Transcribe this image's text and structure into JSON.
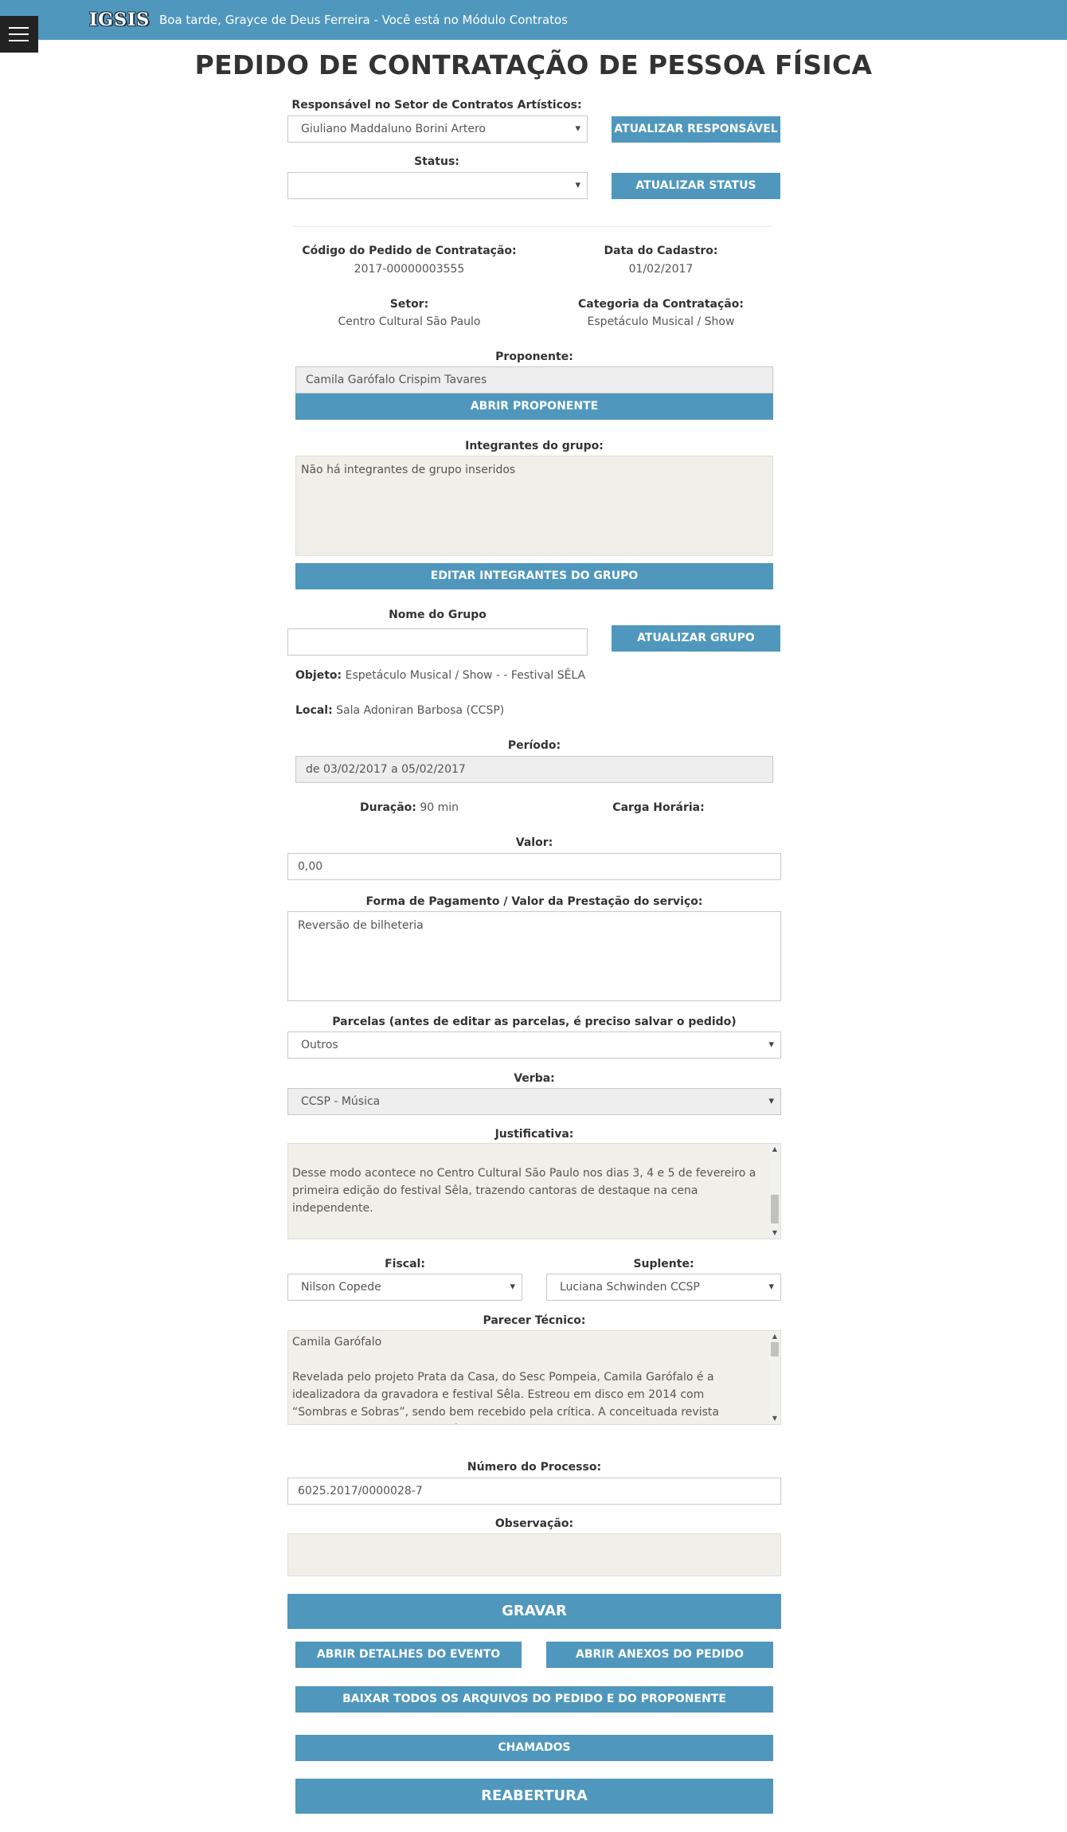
{
  "header": {
    "logo": "IGSIS",
    "greeting": "Boa tarde, Grayce de Deus Ferreira - Você está no Módulo Contratos"
  },
  "page_title": "PEDIDO DE CONTRATAÇÃO DE PESSOA FÍSICA",
  "responsavel": {
    "label": "Responsável no Setor de Contratos Artísticos:",
    "value": "Giuliano Maddaluno Borini Artero",
    "button": "ATUALIZAR RESPONSÁVEL"
  },
  "status": {
    "label": "Status:",
    "value": "",
    "button": "ATUALIZAR STATUS"
  },
  "info": {
    "codigo_label": "Código do Pedido de Contratação:",
    "codigo_value": "2017-00000003555",
    "data_label": "Data do Cadastro:",
    "data_value": "01/02/2017",
    "setor_label": "Setor:",
    "setor_value": "Centro Cultural São Paulo",
    "categoria_label": "Categoria da Contratação:",
    "categoria_value": "Espetáculo Musical / Show"
  },
  "proponente": {
    "label": "Proponente:",
    "value": "Camila Garófalo Crispim Tavares",
    "button": "ABRIR PROPONENTE"
  },
  "integrantes": {
    "label": "Integrantes do grupo:",
    "value": "Não há integrantes de grupo inseridos",
    "button": "EDITAR INTEGRANTES DO GRUPO"
  },
  "grupo": {
    "label": "Nome do Grupo",
    "value": "",
    "button": "ATUALIZAR GRUPO"
  },
  "objeto": {
    "label": "Objeto:",
    "value": "Espetáculo Musical / Show - - Festival SÊLA"
  },
  "local": {
    "label": "Local:",
    "value": "Sala Adoniran Barbosa (CCSP)"
  },
  "periodo": {
    "label": "Período:",
    "value": "de 03/02/2017 a 05/02/2017"
  },
  "duracao": {
    "label": "Duração:",
    "value": "90 min"
  },
  "carga": {
    "label": "Carga Horária:",
    "value": ""
  },
  "valor": {
    "label": "Valor:",
    "value": "0,00"
  },
  "pagamento": {
    "label": "Forma de Pagamento / Valor da Prestação do serviço:",
    "value": "Reversão de bilheteria"
  },
  "parcelas": {
    "label": "Parcelas (antes de editar as parcelas, é preciso salvar o pedido)",
    "value": "Outros"
  },
  "verba": {
    "label": "Verba:",
    "value": "CCSP - Música"
  },
  "justificativa": {
    "label": "Justificativa:",
    "value": "Desse modo acontece no Centro Cultural São Paulo nos dias 3, 4 e 5 de fevereiro a primeira edição do festival Sêla, trazendo cantoras de destaque na cena independente."
  },
  "fiscal": {
    "label": "Fiscal:",
    "value": "Nilson Copede"
  },
  "suplente": {
    "label": "Suplente:",
    "value": "Luciana Schwinden CCSP"
  },
  "parecer": {
    "label": "Parecer Técnico:",
    "line1": "Camila Garófalo",
    "line2": "Revelada pelo projeto Prata da Casa, do Sesc Pompeia, Camila Garófalo é a idealizadora da gravadora e festival Sêla. Estreou em disco em 2014 com “Sombras e Sobras”, sendo bem recebido pela crítica. A conceituada revista Rolling Stone classificou a música de Camila"
  },
  "processo": {
    "label": "Número do Processo:",
    "value": "6025.2017/0000028-7"
  },
  "observacao": {
    "label": "Observação:",
    "value": ""
  },
  "buttons": {
    "gravar": "GRAVAR",
    "detalhes": "ABRIR DETALHES DO EVENTO",
    "anexos": "ABRIR ANEXOS DO PEDIDO",
    "baixar": "BAIXAR TODOS OS ARQUIVOS DO PEDIDO E DO PROPONENTE",
    "chamados": "CHAMADOS",
    "reabertura": "REABERTURA"
  }
}
